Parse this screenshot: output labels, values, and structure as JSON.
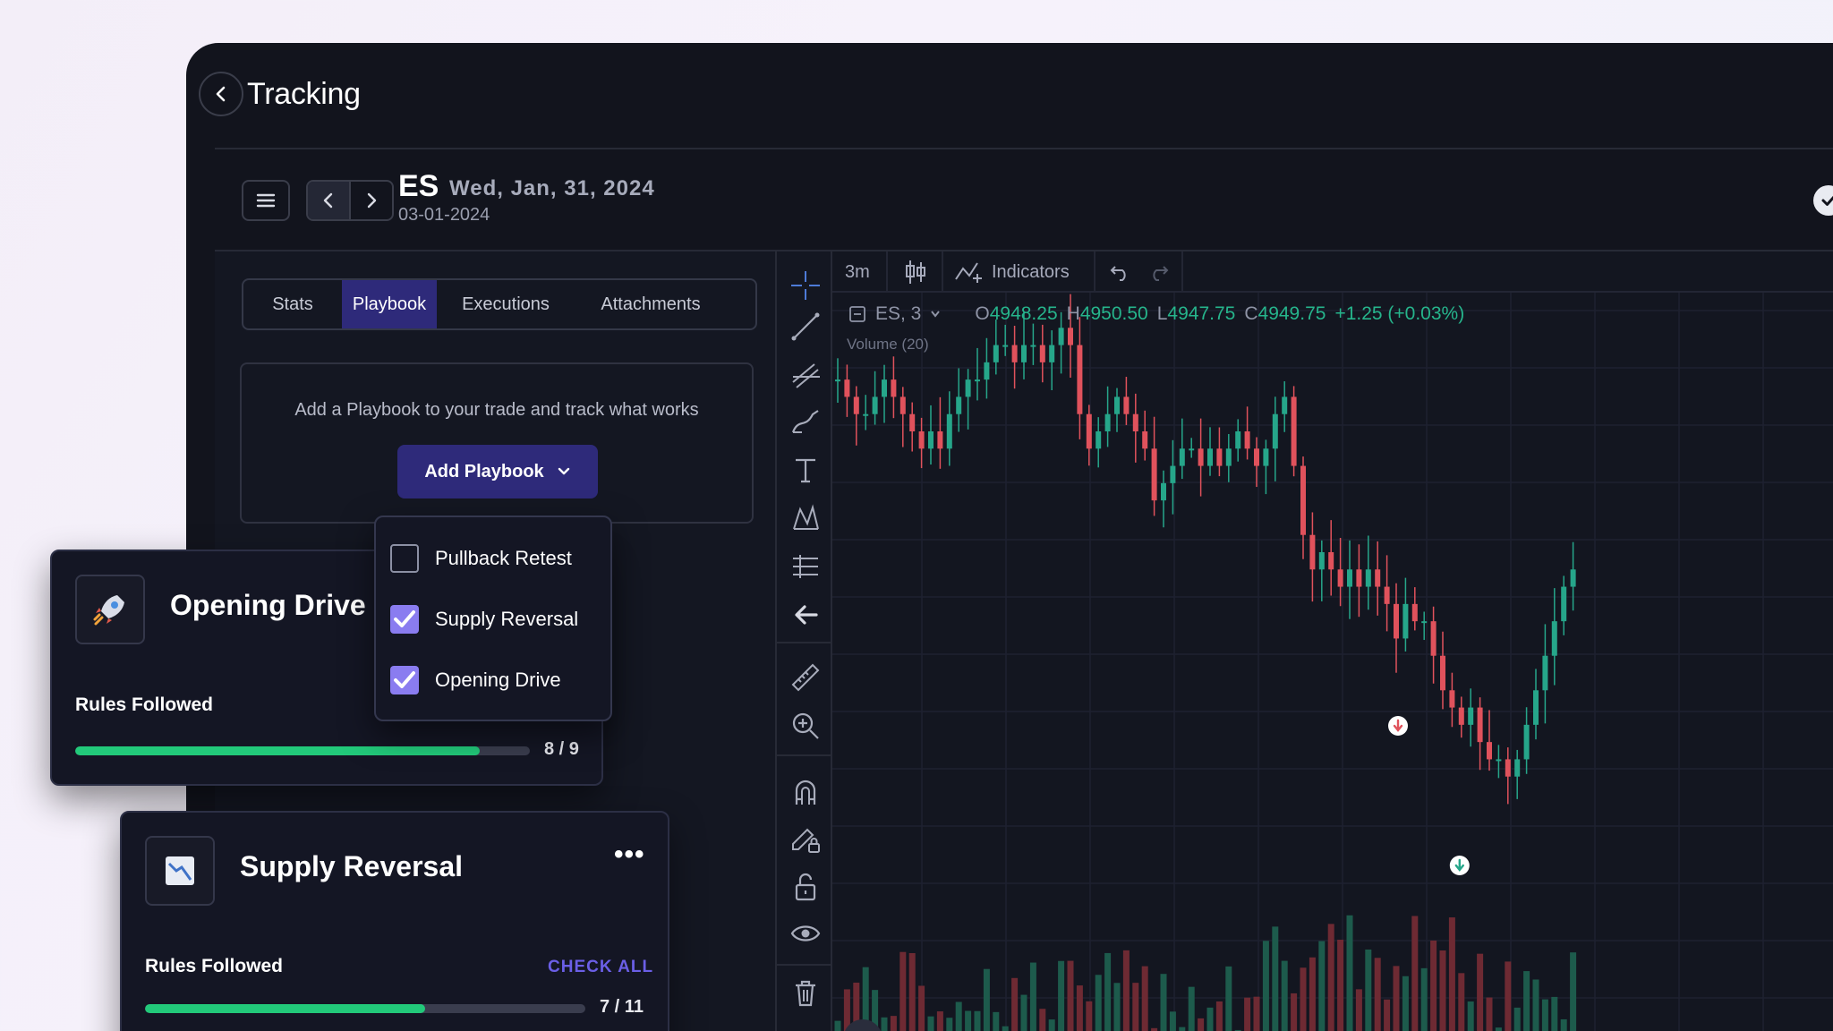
{
  "header": {
    "title": "Tracking"
  },
  "trade": {
    "symbol": "ES",
    "date_main": "Wed, Jan, 31, 2024",
    "date_sub": "03-01-2024"
  },
  "tabs": [
    {
      "label": "Stats",
      "active": false
    },
    {
      "label": "Playbook",
      "active": true
    },
    {
      "label": "Executions",
      "active": false
    },
    {
      "label": "Attachments",
      "active": false
    }
  ],
  "playbook": {
    "message": "Add a Playbook to your trade and track what works",
    "add_label": "Add Playbook"
  },
  "dropdown": {
    "items": [
      {
        "label": "Pullback Retest",
        "checked": false
      },
      {
        "label": "Supply Reversal",
        "checked": true
      },
      {
        "label": "Opening Drive",
        "checked": true
      }
    ]
  },
  "cards": {
    "opening_drive": {
      "icon": "rocket-icon",
      "title": "Opening Drive",
      "rules_label": "Rules Followed",
      "count": "8 / 9",
      "progress": 0.889
    },
    "supply_reversal": {
      "icon": "chart-down-icon",
      "title": "Supply Reversal",
      "rules_label": "Rules Followed",
      "check_all": "CHECK ALL",
      "count": "7 / 11",
      "progress": 0.636
    }
  },
  "chart": {
    "timeframe": "3m",
    "indicators_label": "Indicators",
    "symbol_label": "ES, 3",
    "open_label": "O",
    "open": "4948.25",
    "high_label": "H",
    "high": "4950.50",
    "low_label": "L",
    "low": "4947.75",
    "close_label": "C",
    "close": "4949.75",
    "change": "+1.25 (+0.03%)",
    "volume_label": "Volume (20)",
    "colors": {
      "up": "#26a68a",
      "down": "#e0525c",
      "up_vol": "#1d5b4c",
      "down_vol": "#6e2a33"
    }
  },
  "chart_data": {
    "type": "candlestick",
    "note_hidden": "",
    "trend_closes": [
      4948,
      4947,
      4946,
      4946,
      4947,
      4948,
      4947,
      4946,
      4945,
      4944,
      4945,
      4944,
      4946,
      4947,
      4948,
      4948,
      4949,
      4950,
      4950,
      4949,
      4950,
      4950,
      4949,
      4950,
      4951,
      4950,
      4946,
      4944,
      4945,
      4946,
      4947,
      4946,
      4945,
      4944,
      4941,
      4942,
      4943,
      4944,
      4944,
      4943,
      4944,
      4943,
      4944,
      4945,
      4944,
      4943,
      4944,
      4946,
      4947,
      4943,
      4939,
      4937,
      4938,
      4937,
      4936,
      4937,
      4936,
      4937,
      4936,
      4935,
      4933,
      4935,
      4934,
      4934,
      4932,
      4930,
      4929,
      4928,
      4929,
      4927,
      4926,
      4926,
      4925,
      4926,
      4928,
      4930,
      4932,
      4934,
      4936,
      4937
    ]
  }
}
